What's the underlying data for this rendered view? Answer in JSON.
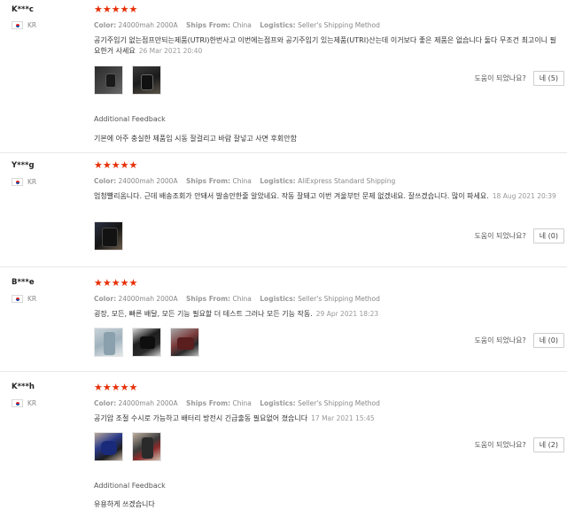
{
  "labels": {
    "color": "Color:",
    "ships_from": "Ships From:",
    "logistics": "Logistics:",
    "helpful": "도움이 되었나요?",
    "additional_feedback": "Additional Feedback"
  },
  "reviews": [
    {
      "user": "K***c",
      "country": "KR",
      "stars": "★★★★★",
      "color": "24000mah 2000A",
      "ships_from": "China",
      "logistics": "Seller's Shipping Method",
      "content": "공기주입기 없는점프만되는제품(UTRI)한번사고 이번에는점프와 공기주입기 있는제품(UTRI)산는데 이거보다 좋은 제품은 없습니다 둘다 무조건 최고이니 필요한거 사세요",
      "date": "26 Mar 2021 20:40",
      "helpful_btn": "네 (5)",
      "additional_feedback": "기본에 아주 충실한 제품임 시동 잘걸리고 바람 잘넣고 사면 후회안함"
    },
    {
      "user": "Y***g",
      "country": "KR",
      "stars": "★★★★★",
      "color": "24000mah 2000A",
      "ships_from": "China",
      "logistics": "AliExpress Standard Shipping",
      "content": "엄청빨리옴니다. 근데 배송조회가 안돼서 발송안한줄 알았네요. 작동 잘돼고 이번 겨울부턴 문제 없겠네요. 잘쓰겠습니다. 많이 파세요.",
      "date": "18 Aug 2021 20:39",
      "helpful_btn": "네 (0)"
    },
    {
      "user": "B***e",
      "country": "KR",
      "stars": "★★★★★",
      "color": "24000mah 2000A",
      "ships_from": "China",
      "logistics": "Seller's Shipping Method",
      "content": "굉장, 모든, 빠른 배달, 모든 기능 필요할 더 테스트 그러나 모든 기능 작동.",
      "date": "29 Apr 2021 18:23",
      "helpful_btn": "네 (0)"
    },
    {
      "user": "K***h",
      "country": "KR",
      "stars": "★★★★★",
      "color": "24000mah 2000A",
      "ships_from": "China",
      "logistics": "Seller's Shipping Method",
      "content": "공기압 조절 수시로 가능하고 배터리 방전시 긴급출동 필요없어 졌습니다",
      "date": "17 Mar 2021 15:45",
      "helpful_btn": "네 (2)",
      "additional_feedback": "유용하게 쓰겠습니다"
    }
  ],
  "colors": {
    "star": "#e62e04",
    "meta": "#888888",
    "divider": "#e8e8e8"
  },
  "icons": {
    "flag": "korea-flag-icon",
    "star": "star-icon"
  }
}
